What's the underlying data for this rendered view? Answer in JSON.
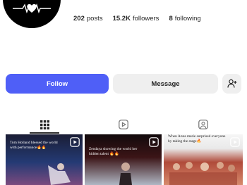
{
  "profile": {
    "stats": [
      {
        "value": "202",
        "label": "posts"
      },
      {
        "value": "15.2K",
        "label": "followers"
      },
      {
        "value": "8",
        "label": "following"
      }
    ]
  },
  "actions": {
    "follow_label": "Follow",
    "message_label": "Message"
  },
  "tabs": [
    {
      "icon": "grid-icon",
      "active": true
    },
    {
      "icon": "reels-icon",
      "active": false
    },
    {
      "icon": "tagged-icon",
      "active": false
    }
  ],
  "posts": [
    {
      "caption": "Tom Holland blessed the world with performance🔥🔥"
    },
    {
      "caption": "Zendaya showing the world her hidden talent 🔥🔥"
    },
    {
      "caption": "When Anna marie surprised everyone by taking the stage🔥"
    }
  ],
  "colors": {
    "accent": "#4f5ff7",
    "secondary_button": "#efefef",
    "text": "#262626"
  }
}
